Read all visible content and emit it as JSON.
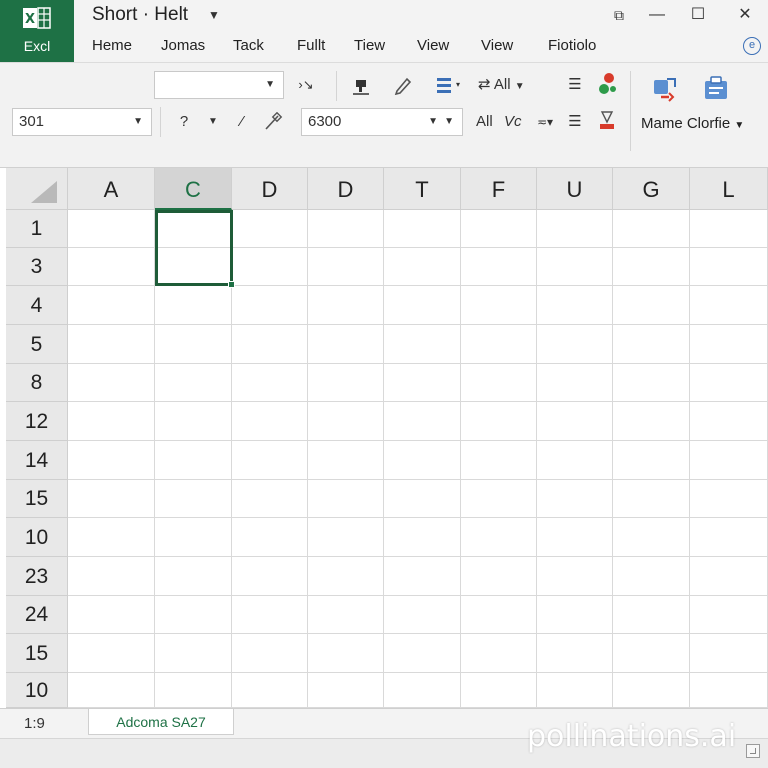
{
  "app": {
    "name": "Excl",
    "document_title": "Short · Helt"
  },
  "window_controls": {
    "minimize": "—",
    "maximize": "☐",
    "close": "✕",
    "extra": "⧉"
  },
  "tabs": [
    "Heme",
    "Jomas",
    "Tack",
    "Fullt",
    "Tiew",
    "View",
    "View",
    "Fiotiolo"
  ],
  "ribbon": {
    "font_name_value": "",
    "font_size_value": "301",
    "number_format_value": "6300",
    "filter_all_label": "All",
    "filter_all_label2": "All",
    "vc_label": "Vc",
    "name_profile_label": "Mame Clorfie",
    "question_label": "?"
  },
  "grid": {
    "columns": [
      "A",
      "C",
      "D",
      "D",
      "T",
      "F",
      "U",
      "G",
      "L"
    ],
    "rows": [
      "1",
      "3",
      "4",
      "5",
      "8",
      "12",
      "14",
      "15",
      "10",
      "23",
      "24",
      "15",
      "10"
    ],
    "selected_column_index": 1
  },
  "sheet": {
    "page_indicator": "1:9",
    "active_sheet": "Adcoma SA27"
  },
  "watermark": "pollinations.ai",
  "colors": {
    "brand": "#1e7145",
    "active_cell_border": "#1e5c38",
    "accent_blue": "#3b6fb6"
  }
}
